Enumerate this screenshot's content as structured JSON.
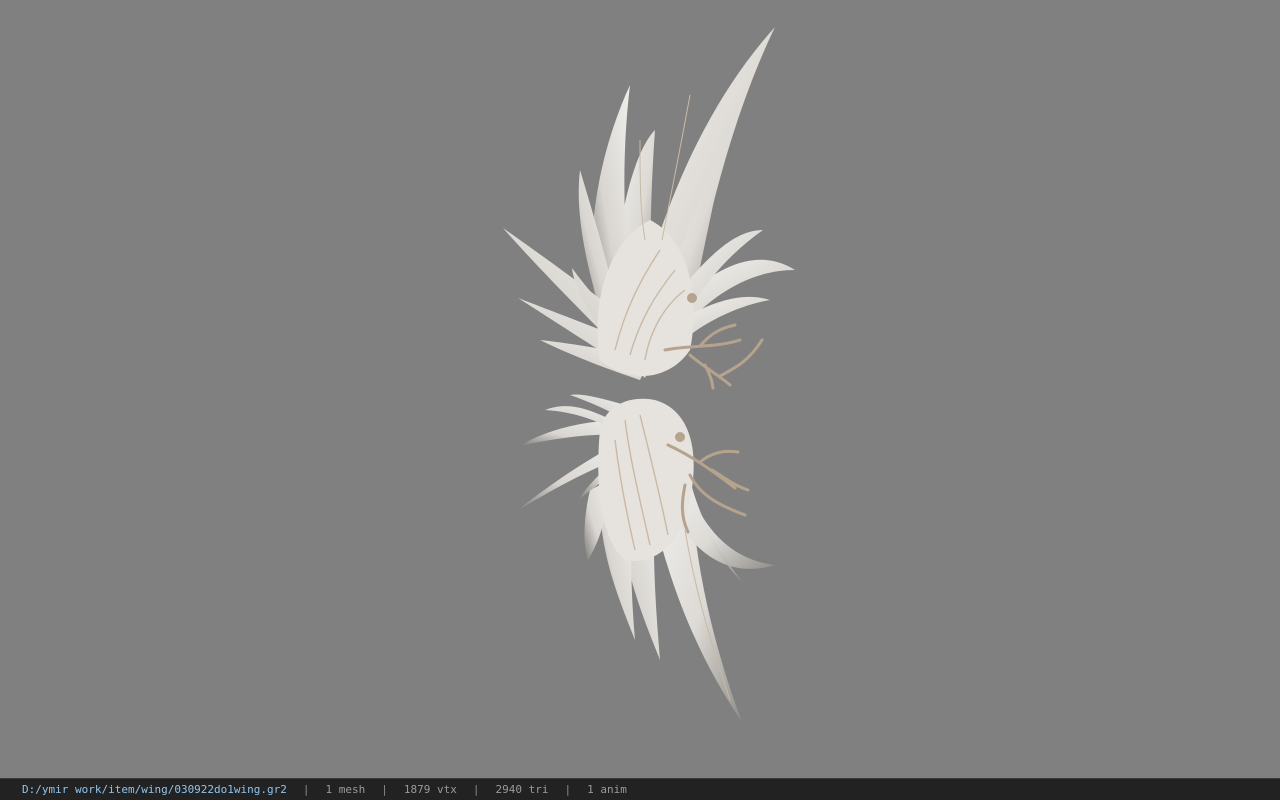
{
  "viewer": {
    "background_color": "#808080",
    "model": {
      "icon": "feather-wing-model",
      "body_color": "#e2e0dc",
      "shadow_color": "#8e8c88",
      "branch_color": "#b5a38e"
    }
  },
  "statusbar": {
    "file_path": "D:/ymir work/item/wing/030922do1wing.gr2",
    "separator": "|",
    "mesh_count": "1 mesh",
    "vertex_count": "1879 vtx",
    "triangle_count": "2940 tri",
    "anim_count": "1 anim",
    "path_color": "#8fc4ec"
  }
}
